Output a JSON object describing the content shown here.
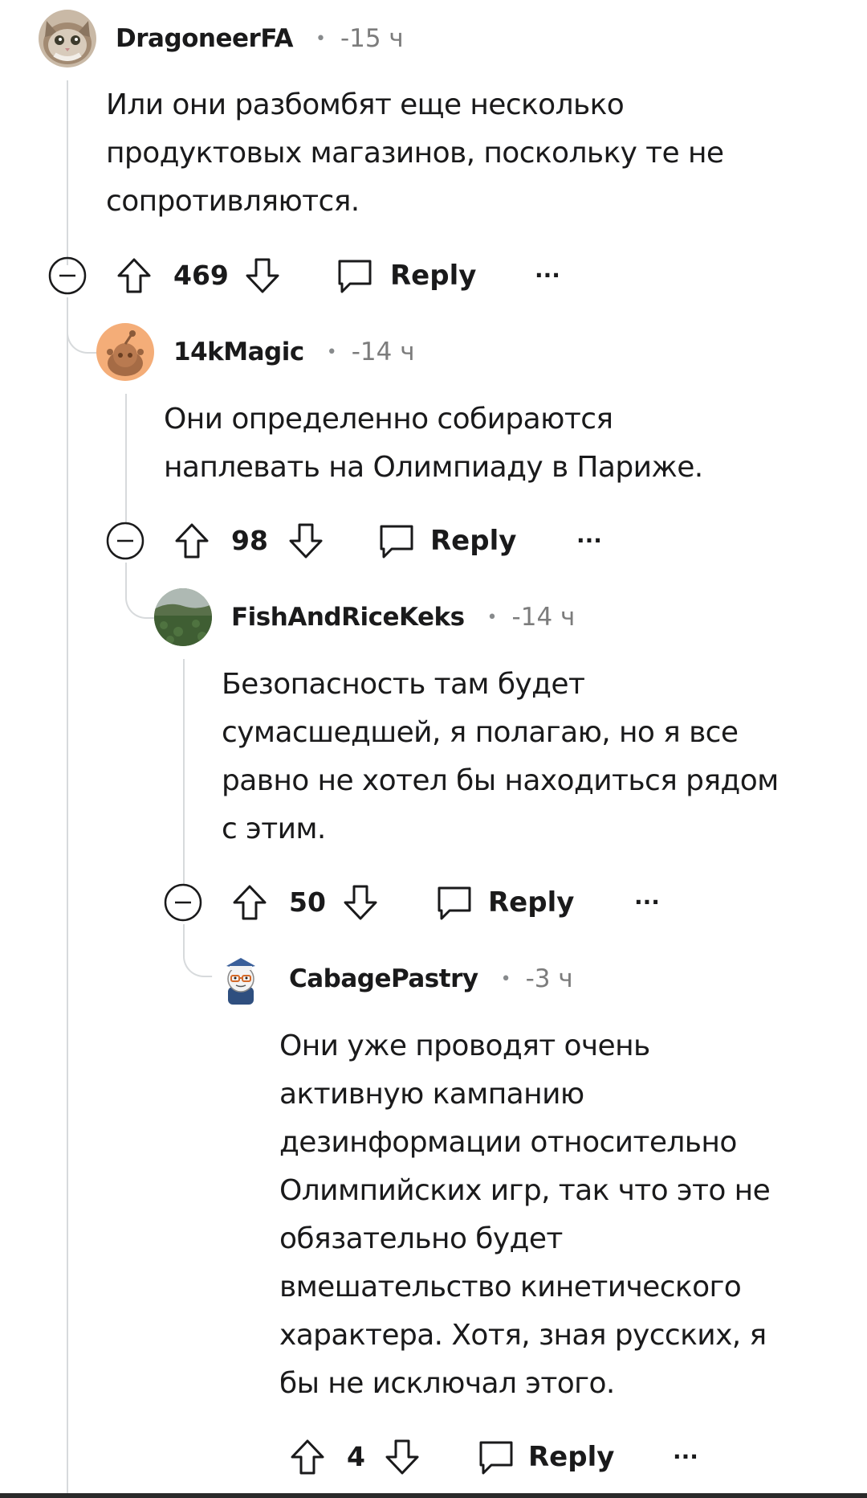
{
  "comments": [
    {
      "username": "DragoneerFA",
      "separator": "•",
      "time": "-15 ч",
      "avatar": "cat-avatar",
      "body": [
        "Или они разбомбят еще несколько",
        "продуктовых магазинов, поскольку те не",
        "сопротивляются."
      ],
      "score": "469",
      "reply_label": "Reply",
      "more_label": "···"
    },
    {
      "username": "14kMagic",
      "separator": "•",
      "time": "-14 ч",
      "avatar": "default-snoo-avatar",
      "body": [
        "Они определенно собираются",
        "наплевать на Олимпиаду в Париже."
      ],
      "score": "98",
      "reply_label": "Reply",
      "more_label": "···"
    },
    {
      "username": "FishAndRiceKeks",
      "separator": "•",
      "time": "-14 ч",
      "avatar": "landscape-avatar",
      "body": [
        "Безопасность там будет",
        "сумасшедшей, я полагаю, но я все",
        "равно не хотел бы находиться рядом",
        "с этим."
      ],
      "score": "50",
      "reply_label": "Reply",
      "more_label": "···"
    },
    {
      "username": "CabagePastry",
      "separator": "•",
      "time": "-3 ч",
      "avatar": "snoo-sailor-avatar",
      "body": [
        "Они уже проводят очень",
        "активную кампанию",
        "дезинформации относительно",
        "Олимпийских игр, так что это не",
        "обязательно будет",
        "вмешательство кинетического",
        "характера. Хотя, зная русских, я",
        "бы не исключал этого."
      ],
      "score": "4",
      "reply_label": "Reply",
      "more_label": "···"
    }
  ],
  "colors": {
    "thread_line": "#d7dadc",
    "text": "#1a1a1b",
    "muted": "#7c7c7c"
  }
}
